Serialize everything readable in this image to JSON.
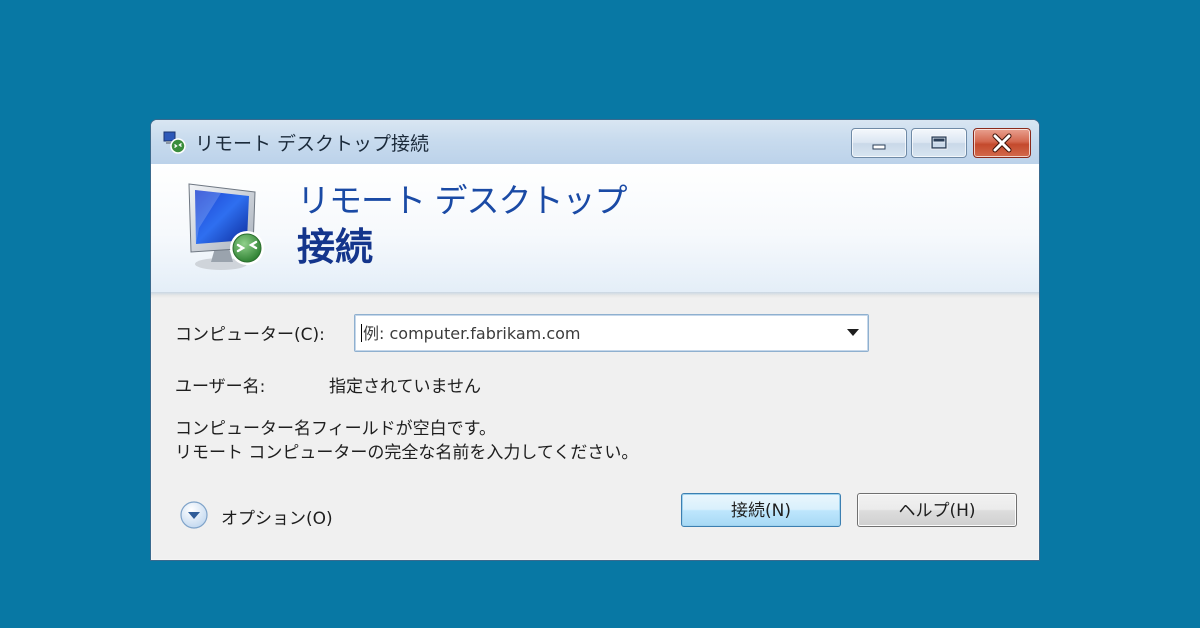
{
  "window": {
    "title": "リモート デスクトップ接続",
    "buttons": {
      "minimize_icon": "minimize-icon",
      "maximize_icon": "maximize-icon",
      "close_icon": "close-icon"
    }
  },
  "banner": {
    "line1": "リモート デスクトップ",
    "line2": "接続",
    "icon": "remote-desktop-monitor-icon"
  },
  "form": {
    "computer_label": "コンピューター(C):",
    "computer_input_value": "",
    "computer_input_placeholder": "例: computer.fabrikam.com",
    "user_label": "ユーザー名:",
    "user_value": "指定されていません",
    "message_line1": "コンピューター名フィールドが空白です。",
    "message_line2": "リモート コンピューターの完全な名前を入力してください。"
  },
  "footer": {
    "options_label": "オプション(O)",
    "connect_label": "接続(N)",
    "help_label": "ヘルプ(H)"
  },
  "colors": {
    "desktop": "#0878a4",
    "banner_text": "#1a4aa5",
    "close_button": "#c44a2d"
  }
}
